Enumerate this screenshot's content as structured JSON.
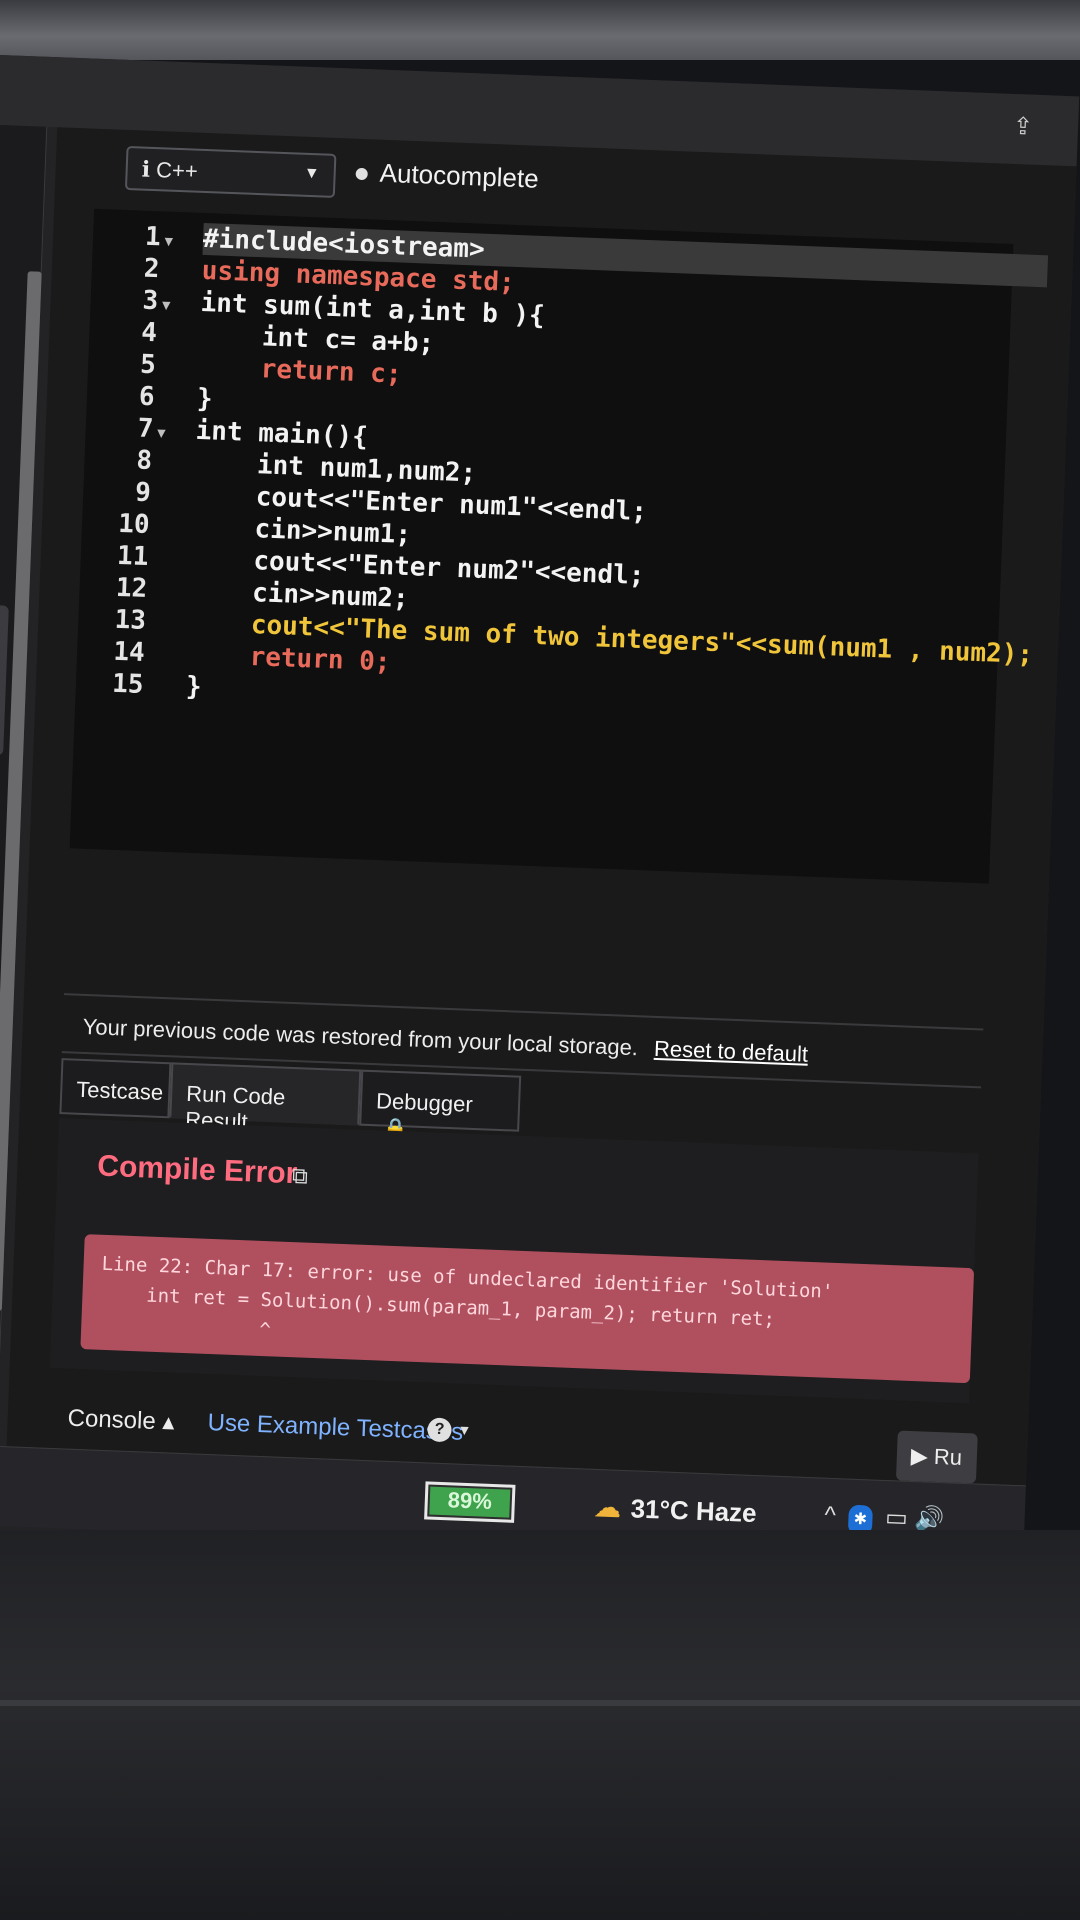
{
  "language": {
    "selected": "C++",
    "caret": "▼"
  },
  "autocomplete_label": "Autocomplete",
  "code": {
    "line_numbers": [
      "1",
      "2",
      "3",
      "4",
      "5",
      "6",
      "7",
      "8",
      "9",
      "10",
      "11",
      "12",
      "13",
      "14",
      "15"
    ],
    "lines": [
      "#include<iostream>",
      "using namespace std;",
      "int sum(int a,int b ){",
      "    int c= a+b;",
      "    return c;",
      "}",
      "int main(){",
      "    int num1,num2;",
      "    cout<<\"Enter num1\"<<endl;",
      "    cin>>num1;",
      "    cout<<\"Enter num2\"<<endl;",
      "    cin>>num2;",
      "    cout<<\"The sum of two integers\"<<sum(num1 , num2);",
      "    return 0;",
      "}"
    ]
  },
  "restore_message": "Your previous code was restored from your local storage.",
  "reset_link": "Reset to default",
  "tabs": [
    {
      "label": "Testcase"
    },
    {
      "label": "Run Code Result"
    },
    {
      "label": "Debugger"
    }
  ],
  "result": {
    "title": "Compile Error",
    "error_lines": [
      "Line 22: Char 17: error: use of undeclared identifier 'Solution'",
      "    int ret = Solution().sum(param_1, param_2); return ret;",
      "              ^"
    ]
  },
  "footer": {
    "console": "Console",
    "console_caret": "▴",
    "example_testcases": "Use Example Testcases",
    "help": "?",
    "run": "▶ Ru"
  },
  "taskbar": {
    "battery": "89%",
    "weather": "31°C Haze"
  },
  "colors": {
    "error": "#ff6b7f",
    "keyword": "#e86a5a",
    "function": "#f0c53a"
  }
}
